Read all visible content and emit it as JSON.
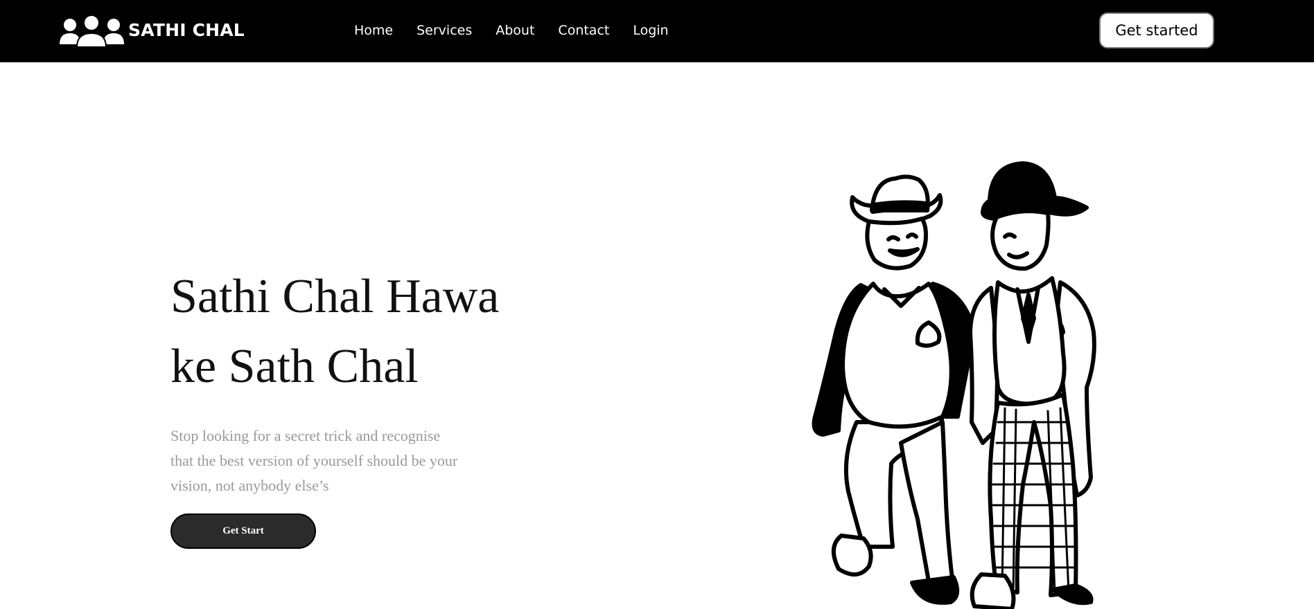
{
  "brand": {
    "name": "SATHI CHAL",
    "logo_icon": "group-of-people-icon"
  },
  "nav": {
    "links": [
      "Home",
      "Services",
      "About",
      "Contact",
      "Login"
    ]
  },
  "header": {
    "cta_label": "Get started"
  },
  "hero": {
    "title_line1": "Sathi Chal Hawa",
    "title_line2": "ke Sath Chal",
    "text_line1": "Stop looking for a secret trick and recognise",
    "text_line2": "that the best version of yourself should be your",
    "text_line3": "vision, not anybody else’s",
    "button_label": "Get Start",
    "illustration": "two-men-walking-cartoon"
  },
  "colors": {
    "navbar_bg": "#000000",
    "page_bg": "#ffffff",
    "button_dark": "#2b2b2b",
    "muted_text": "#999999"
  }
}
